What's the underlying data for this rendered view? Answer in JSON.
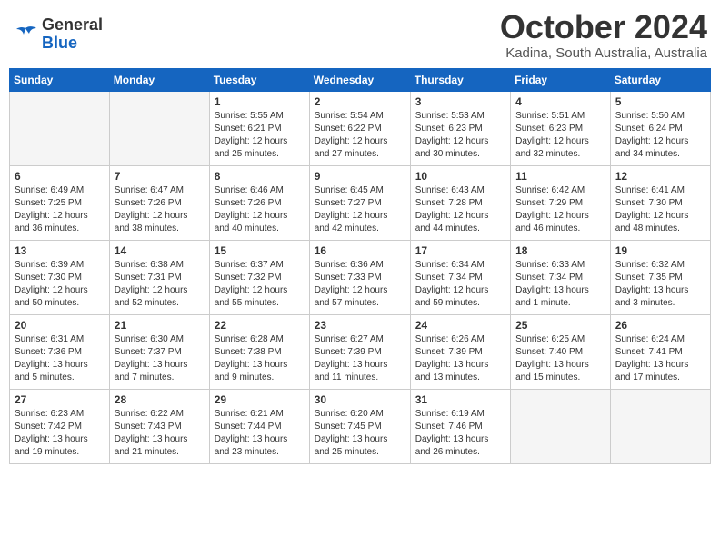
{
  "logo": {
    "general": "General",
    "blue": "Blue"
  },
  "title": "October 2024",
  "location": "Kadina, South Australia, Australia",
  "days_of_week": [
    "Sunday",
    "Monday",
    "Tuesday",
    "Wednesday",
    "Thursday",
    "Friday",
    "Saturday"
  ],
  "weeks": [
    [
      {
        "day": "",
        "info": ""
      },
      {
        "day": "",
        "info": ""
      },
      {
        "day": "1",
        "info": "Sunrise: 5:55 AM\nSunset: 6:21 PM\nDaylight: 12 hours and 25 minutes."
      },
      {
        "day": "2",
        "info": "Sunrise: 5:54 AM\nSunset: 6:22 PM\nDaylight: 12 hours and 27 minutes."
      },
      {
        "day": "3",
        "info": "Sunrise: 5:53 AM\nSunset: 6:23 PM\nDaylight: 12 hours and 30 minutes."
      },
      {
        "day": "4",
        "info": "Sunrise: 5:51 AM\nSunset: 6:23 PM\nDaylight: 12 hours and 32 minutes."
      },
      {
        "day": "5",
        "info": "Sunrise: 5:50 AM\nSunset: 6:24 PM\nDaylight: 12 hours and 34 minutes."
      }
    ],
    [
      {
        "day": "6",
        "info": "Sunrise: 6:49 AM\nSunset: 7:25 PM\nDaylight: 12 hours and 36 minutes."
      },
      {
        "day": "7",
        "info": "Sunrise: 6:47 AM\nSunset: 7:26 PM\nDaylight: 12 hours and 38 minutes."
      },
      {
        "day": "8",
        "info": "Sunrise: 6:46 AM\nSunset: 7:26 PM\nDaylight: 12 hours and 40 minutes."
      },
      {
        "day": "9",
        "info": "Sunrise: 6:45 AM\nSunset: 7:27 PM\nDaylight: 12 hours and 42 minutes."
      },
      {
        "day": "10",
        "info": "Sunrise: 6:43 AM\nSunset: 7:28 PM\nDaylight: 12 hours and 44 minutes."
      },
      {
        "day": "11",
        "info": "Sunrise: 6:42 AM\nSunset: 7:29 PM\nDaylight: 12 hours and 46 minutes."
      },
      {
        "day": "12",
        "info": "Sunrise: 6:41 AM\nSunset: 7:30 PM\nDaylight: 12 hours and 48 minutes."
      }
    ],
    [
      {
        "day": "13",
        "info": "Sunrise: 6:39 AM\nSunset: 7:30 PM\nDaylight: 12 hours and 50 minutes."
      },
      {
        "day": "14",
        "info": "Sunrise: 6:38 AM\nSunset: 7:31 PM\nDaylight: 12 hours and 52 minutes."
      },
      {
        "day": "15",
        "info": "Sunrise: 6:37 AM\nSunset: 7:32 PM\nDaylight: 12 hours and 55 minutes."
      },
      {
        "day": "16",
        "info": "Sunrise: 6:36 AM\nSunset: 7:33 PM\nDaylight: 12 hours and 57 minutes."
      },
      {
        "day": "17",
        "info": "Sunrise: 6:34 AM\nSunset: 7:34 PM\nDaylight: 12 hours and 59 minutes."
      },
      {
        "day": "18",
        "info": "Sunrise: 6:33 AM\nSunset: 7:34 PM\nDaylight: 13 hours and 1 minute."
      },
      {
        "day": "19",
        "info": "Sunrise: 6:32 AM\nSunset: 7:35 PM\nDaylight: 13 hours and 3 minutes."
      }
    ],
    [
      {
        "day": "20",
        "info": "Sunrise: 6:31 AM\nSunset: 7:36 PM\nDaylight: 13 hours and 5 minutes."
      },
      {
        "day": "21",
        "info": "Sunrise: 6:30 AM\nSunset: 7:37 PM\nDaylight: 13 hours and 7 minutes."
      },
      {
        "day": "22",
        "info": "Sunrise: 6:28 AM\nSunset: 7:38 PM\nDaylight: 13 hours and 9 minutes."
      },
      {
        "day": "23",
        "info": "Sunrise: 6:27 AM\nSunset: 7:39 PM\nDaylight: 13 hours and 11 minutes."
      },
      {
        "day": "24",
        "info": "Sunrise: 6:26 AM\nSunset: 7:39 PM\nDaylight: 13 hours and 13 minutes."
      },
      {
        "day": "25",
        "info": "Sunrise: 6:25 AM\nSunset: 7:40 PM\nDaylight: 13 hours and 15 minutes."
      },
      {
        "day": "26",
        "info": "Sunrise: 6:24 AM\nSunset: 7:41 PM\nDaylight: 13 hours and 17 minutes."
      }
    ],
    [
      {
        "day": "27",
        "info": "Sunrise: 6:23 AM\nSunset: 7:42 PM\nDaylight: 13 hours and 19 minutes."
      },
      {
        "day": "28",
        "info": "Sunrise: 6:22 AM\nSunset: 7:43 PM\nDaylight: 13 hours and 21 minutes."
      },
      {
        "day": "29",
        "info": "Sunrise: 6:21 AM\nSunset: 7:44 PM\nDaylight: 13 hours and 23 minutes."
      },
      {
        "day": "30",
        "info": "Sunrise: 6:20 AM\nSunset: 7:45 PM\nDaylight: 13 hours and 25 minutes."
      },
      {
        "day": "31",
        "info": "Sunrise: 6:19 AM\nSunset: 7:46 PM\nDaylight: 13 hours and 26 minutes."
      },
      {
        "day": "",
        "info": ""
      },
      {
        "day": "",
        "info": ""
      }
    ]
  ]
}
